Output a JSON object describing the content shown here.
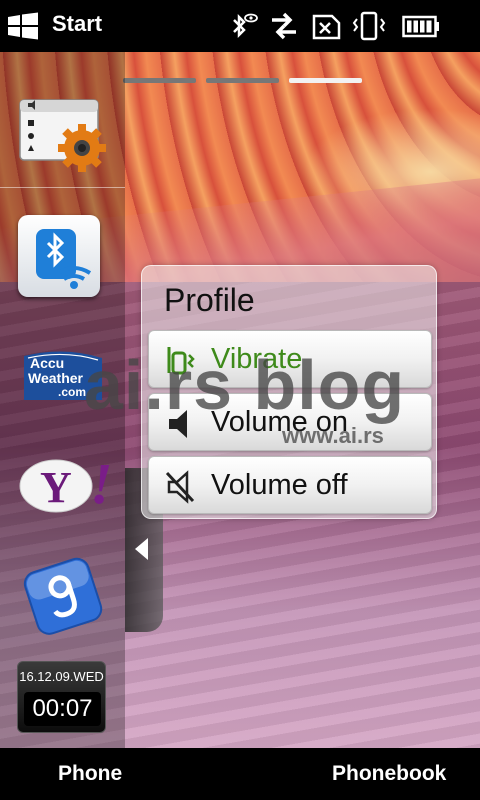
{
  "statusbar": {
    "start_label": "Start",
    "icons": [
      "windows-logo-icon",
      "bluetooth-icon",
      "data-sync-icon",
      "no-sim-icon",
      "vibrate-mode-icon",
      "battery-icon"
    ]
  },
  "page_indicators": {
    "count": 3,
    "active_index": 2
  },
  "left_column": {
    "shortcuts": [
      "settings-icon",
      "bluetooth-settings-icon",
      "accuweather-icon",
      "yahoo-icon",
      "google-icon"
    ],
    "accuweather": {
      "line1": "Accu",
      "line2": "Weather",
      "line3": ".com"
    },
    "yahoo": {
      "text": "Y",
      "exclaim": "!"
    },
    "clock": {
      "date": "16.12.09.WED",
      "hours": "00",
      "separator": ":",
      "minutes": "07"
    }
  },
  "profile": {
    "title": "Profile",
    "options": [
      {
        "label": "Vibrate",
        "icon": "vibrate-icon"
      },
      {
        "label": "Volume on",
        "icon": "speaker-icon"
      },
      {
        "label": "Volume off",
        "icon": "speaker-muted-icon"
      }
    ]
  },
  "watermark": {
    "big": "ai.rs blog",
    "small": "www.ai.rs"
  },
  "softkeys": {
    "left": "Phone",
    "right": "Phonebook"
  },
  "colors": {
    "vibrate_label": "#3e8a1a",
    "bluetooth_blue": "#1f7fd8",
    "yahoo_purple": "#6b1a7a",
    "google_blue": "#2f6fd8"
  }
}
